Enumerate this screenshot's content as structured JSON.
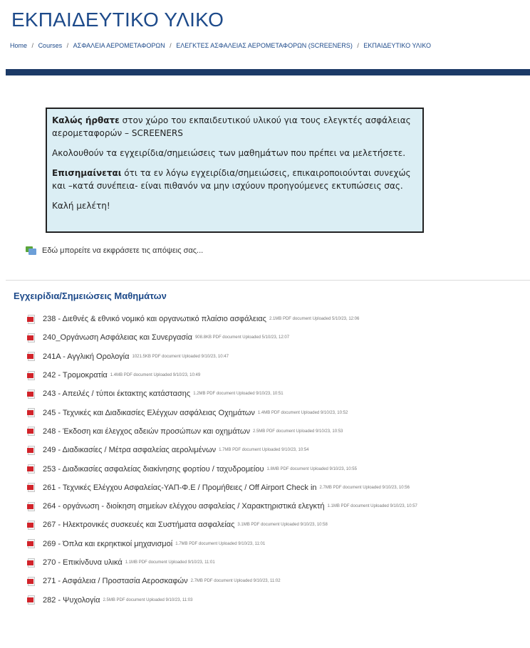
{
  "header": {
    "title": "ΕΚΠΑΙΔΕΥΤΙΚΟ ΥΛΙΚΟ",
    "breadcrumb": [
      "Home",
      "Courses",
      "ΑΣΦΑΛΕΙΑ ΑΕΡΟΜΕΤΑΦΟΡΩΝ",
      "ΕΛΕΓΚΤΕΣ ΑΣΦΑΛΕΙΑΣ ΑΕΡΟΜΕΤΑΦΟΡΩΝ (SCREENERS)",
      "ΕΚΠΑΙΔΕΥΤΙΚΟ ΥΛΙΚΟ"
    ],
    "breadcrumb_separator": "/"
  },
  "welcome": {
    "p1_bold": "Καλώς ήρθατε",
    "p1_rest": " στον χώρο του εκπαιδευτικού υλικού για τους ελεγκτές ασφάλειας αερομεταφορών – SCREENERS",
    "p2": "Ακολουθούν τα εγχειρίδια/σημειώσεις των μαθημάτων που πρέπει να μελετήσετε.",
    "p3_bold": "Επισημαίνεται",
    "p3_rest": " ότι τα εν λόγω εγχειρίδια/σημειώσεις, επικαιροποιούνται συνεχώς και –κατά συνέπεια- είναι πιθανόν να μην ισχύουν προηγούμενες εκτυπώσεις σας.",
    "p4": "Καλή μελέτη!"
  },
  "feedback": {
    "label": "Εδώ μπορείτε να εκφράσετε τις απόψεις σας..."
  },
  "section": {
    "title": "Εγχειρίδια/Σημειώσεις Μαθημάτων"
  },
  "files": [
    {
      "name": "238 - Διεθνές & εθνικό νομικό και οργανωτικό πλαίσιο ασφάλειας",
      "meta": "2.1MB PDF document Uploaded 5/10/23, 12:06"
    },
    {
      "name": "240_Οργάνωση Ασφάλειας και Συνεργασία",
      "meta": "908.8KB PDF document Uploaded 5/10/23, 12:07"
    },
    {
      "name": "241Α - Αγγλική Ορολογία",
      "meta": "1021.5KB PDF document Uploaded 9/10/23, 10:47"
    },
    {
      "name": "242 - Τρομοκρατία",
      "meta": "1.4MB PDF document Uploaded 9/10/23, 10:49"
    },
    {
      "name": "243 - Απειλές / τύποι έκτακτης κατάστασης",
      "meta": "1.2MB PDF document Uploaded 9/10/23, 10:51"
    },
    {
      "name": "245 - Τεχνικές και Διαδικασίες Ελέγχων ασφάλειας Οχημάτων",
      "meta": "1.4MB PDF document Uploaded 9/10/23, 10:52"
    },
    {
      "name": "248 - Έκδοση και έλεγχος αδειών προσώπων και οχημάτων",
      "meta": "2.5MB PDF document Uploaded 9/10/23, 10:53"
    },
    {
      "name": "249 - Διαδικασίες / Μέτρα ασφαλείας αερολιμένων",
      "meta": "1.7MB PDF document Uploaded 9/10/23, 10:54"
    },
    {
      "name": "253 - Διαδικασίες ασφαλείας διακίνησης φορτίου / ταχυδρομείου",
      "meta": "1.8MB PDF document Uploaded 9/10/23, 10:55"
    },
    {
      "name": "261 - Τεχνικές Ελέγχου Ασφαλείας-ΥΑΠ-Φ.Ε / Προμήθειες / Off Airport Check in",
      "meta": "2.7MB PDF document Uploaded 9/10/23, 10:56"
    },
    {
      "name": "264 - οργάνωση - διοίκηση σημείων ελέγχου ασφαλείας / Χαρακτηριστικά ελεγκτή",
      "meta": "1.1MB PDF document Uploaded 9/10/23, 10:57"
    },
    {
      "name": "267 - Ηλεκτρονικές συσκευές και Συστήματα ασφαλείας",
      "meta": "3.1MB PDF document Uploaded 9/10/23, 10:58"
    },
    {
      "name": "269 - Όπλα και εκρηκτικοί μηχανισμοί",
      "meta": "1.7MB PDF document Uploaded 9/10/23, 11:01"
    },
    {
      "name": "270 - Επικίνδυνα υλικά",
      "meta": "1.1MB PDF document Uploaded 9/10/23, 11:01"
    },
    {
      "name": "271 - Ασφάλεια / Προστασία Αεροσκαφών",
      "meta": "2.7MB PDF document Uploaded 9/10/23, 11:02"
    },
    {
      "name": "282 - Ψυχολογία",
      "meta": "2.5MB PDF document Uploaded 9/10/23, 11:03"
    }
  ],
  "colors": {
    "accent": "#1d4a8a",
    "nav_bar": "#1c3a67",
    "box_bg": "#dbeef4",
    "pdf_red": "#d2232a"
  },
  "icons": {
    "file": "pdf-icon",
    "feedback": "forum-icon"
  }
}
